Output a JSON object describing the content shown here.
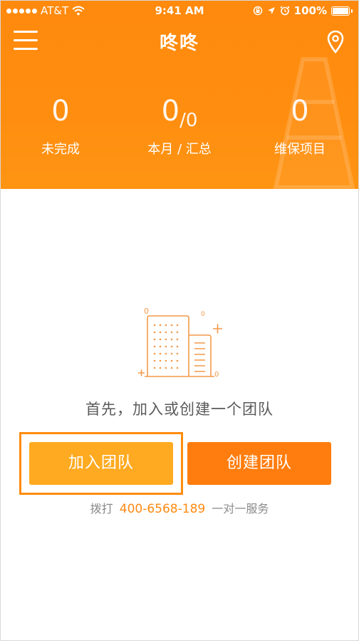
{
  "status_bar": {
    "carrier": "AT&T",
    "time": "9:41 AM",
    "battery": "100%"
  },
  "nav": {
    "title": "咚咚"
  },
  "stats": [
    {
      "value": "0",
      "label": "未完成"
    },
    {
      "value": "0",
      "value_sub": "0",
      "label": "本月 / 汇总"
    },
    {
      "value": "0",
      "label": "维保项目"
    }
  ],
  "empty_state": {
    "prompt": "首先，加入或创建一个团队"
  },
  "actions": {
    "join_label": "加入团队",
    "create_label": "创建团队"
  },
  "hotline": {
    "prefix": "拨打",
    "phone": "400-6568-189",
    "suffix": "一对一服务"
  },
  "colors": {
    "header": "#ff8a0d",
    "join_button": "#ffaa20",
    "create_button": "#ff7d0e",
    "highlight_border": "#ff8c0e"
  },
  "icons": [
    "signal-dots-icon",
    "wifi-icon",
    "lock-rotation-icon",
    "location-arrow-icon",
    "alarm-icon",
    "battery-icon",
    "menu-icon",
    "map-pin-icon",
    "building-illustration",
    "traffic-cone-icon"
  ]
}
